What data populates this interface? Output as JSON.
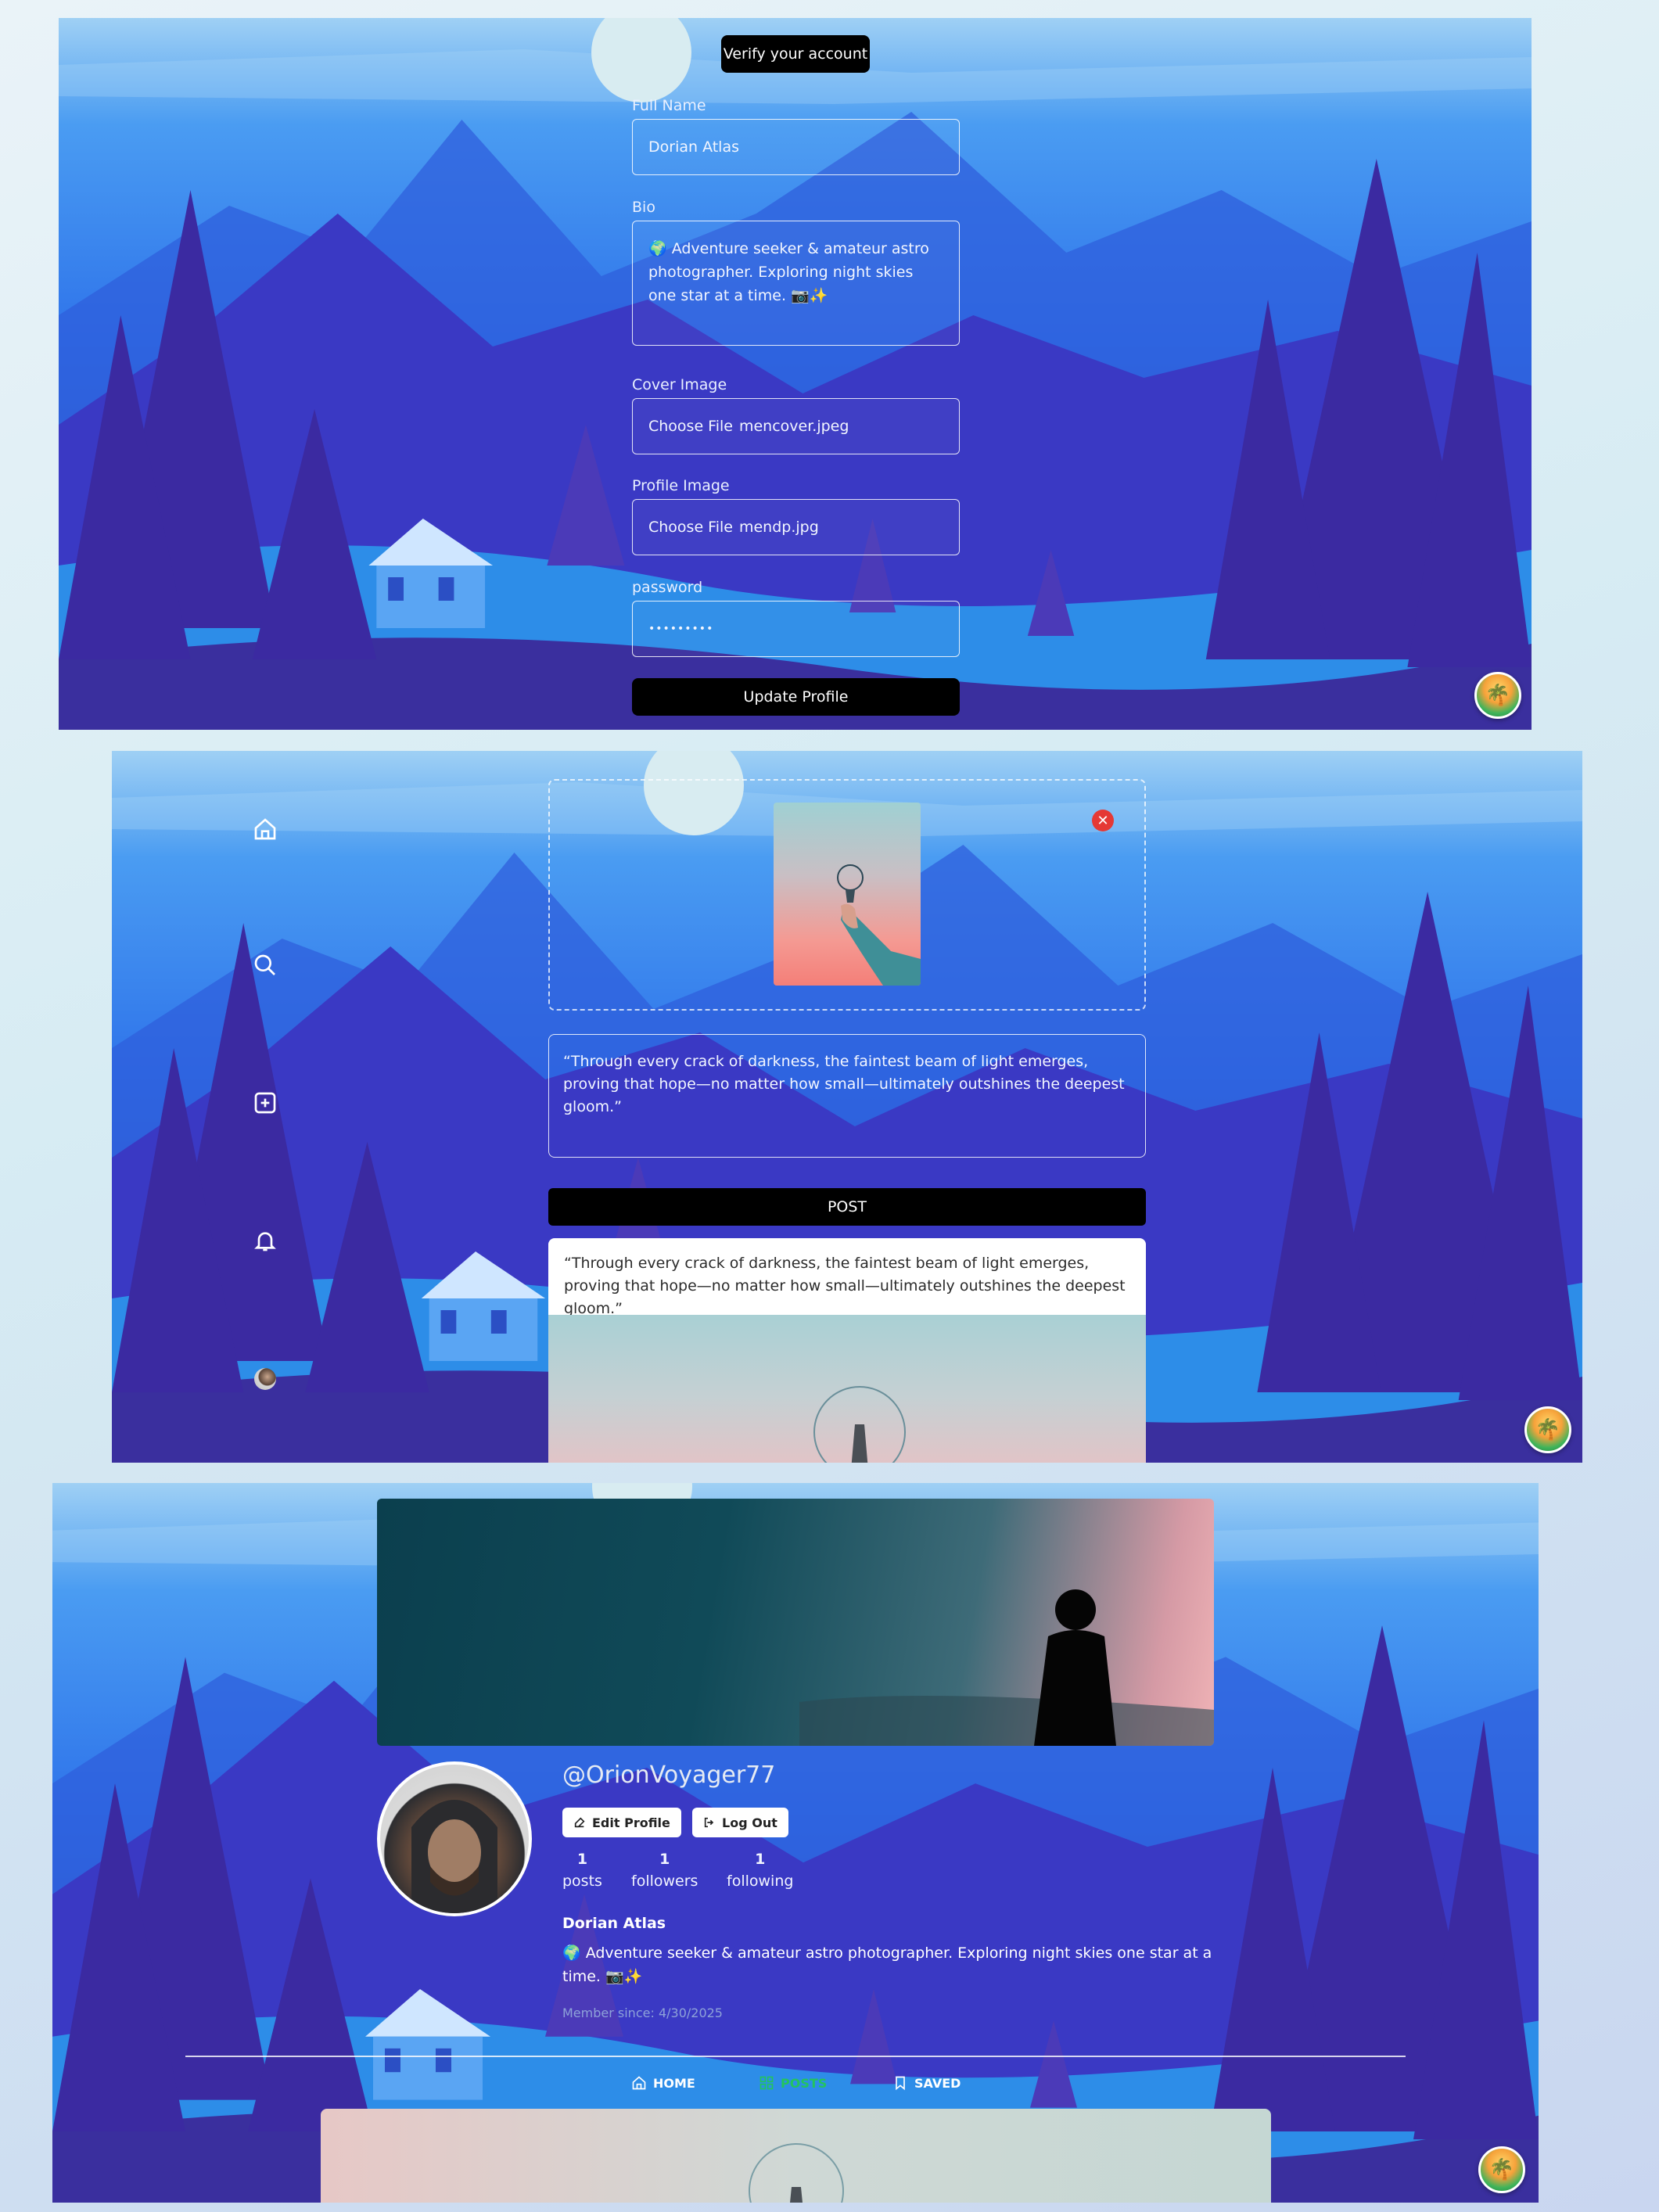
{
  "edit_profile": {
    "verify_button": "Verify your account",
    "full_name": {
      "label": "Full Name",
      "value": "Dorian Atlas"
    },
    "bio": {
      "label": "Bio",
      "value": "🌍 Adventure seeker & amateur astro photographer. Exploring night skies one star at a time. 📷✨"
    },
    "cover_image": {
      "label": "Cover Image",
      "button": "Choose File",
      "filename": "mencover.jpeg"
    },
    "profile_image": {
      "label": "Profile Image",
      "button": "Choose File",
      "filename": "mendp.jpg"
    },
    "password": {
      "label": "password",
      "value": "•••••••••"
    },
    "update_button": "Update Profile"
  },
  "create_post": {
    "sidebar_icons": [
      "home-icon",
      "search-icon",
      "add-post-icon",
      "bell-icon",
      "avatar"
    ],
    "caption": "“Through every crack of darkness, the faintest beam of light emerges, proving that hope—no matter how small—ultimately outshines the deepest gloom.”",
    "post_button": "POST",
    "feed_caption": "“Through every crack of darkness, the faintest beam of light emerges, proving that hope—no matter how small—ultimately outshines the deepest gloom.”"
  },
  "profile": {
    "username": "@OrionVoyager77",
    "edit_profile_button": "Edit Profile",
    "logout_button": "Log Out",
    "stats": [
      {
        "value": "1",
        "label": "posts"
      },
      {
        "value": "1",
        "label": "followers"
      },
      {
        "value": "1",
        "label": "following"
      }
    ],
    "display_name": "Dorian Atlas",
    "bio": "🌍 Adventure seeker & amateur astro photographer. Exploring night skies one star at a time. 📷✨",
    "member_since": "Member since: 4/30/2025",
    "tabs": [
      {
        "label": "HOME",
        "icon": "home-icon",
        "active": false
      },
      {
        "label": "POSTS",
        "icon": "grid-icon",
        "active": true
      },
      {
        "label": "SAVED",
        "icon": "bookmark-icon",
        "active": false
      }
    ]
  },
  "colors": {
    "accent_active_tab": "#23c45e",
    "remove_button": "#e53935",
    "button_dark": "#000000"
  }
}
